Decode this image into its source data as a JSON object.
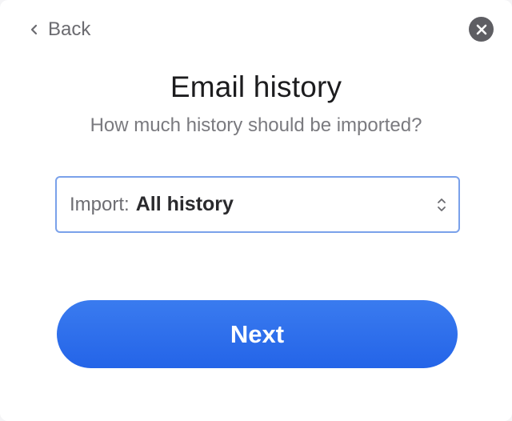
{
  "header": {
    "back_label": "Back",
    "back_icon": "chevron-left-icon",
    "close_icon": "close-icon"
  },
  "main": {
    "title": "Email history",
    "subtitle": "How much history should be imported?",
    "import_select": {
      "prefix": "Import:",
      "selected_value": "All history",
      "icon": "up-down-chevron-icon"
    },
    "next_label": "Next"
  },
  "colors": {
    "accent": "#2a6cec",
    "select_border": "#7aa1ea",
    "close_bg": "#5e5e63"
  }
}
